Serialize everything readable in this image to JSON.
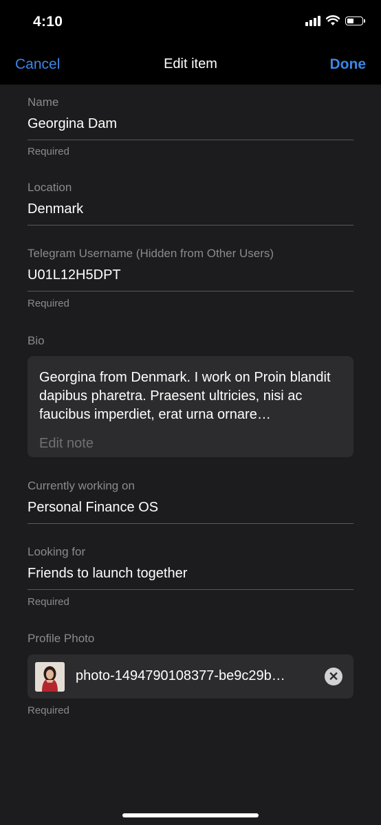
{
  "status": {
    "time": "4:10"
  },
  "nav": {
    "cancel": "Cancel",
    "title": "Edit item",
    "done": "Done"
  },
  "fields": {
    "name": {
      "label": "Name",
      "value": "Georgina Dam",
      "help": "Required"
    },
    "location": {
      "label": "Location",
      "value": "Denmark"
    },
    "telegram": {
      "label": "Telegram Username (Hidden from Other Users)",
      "value": "U01L12H5DPT",
      "help": "Required"
    },
    "bio": {
      "label": "Bio",
      "value": "Georgina from Denmark. I work on Proin blandit dapibus pharetra. Praesent ultricies, nisi ac faucibus imperdiet, erat urna ornare…",
      "edit_placeholder": "Edit note"
    },
    "working_on": {
      "label": "Currently working on",
      "value": "Personal Finance OS"
    },
    "looking_for": {
      "label": "Looking for",
      "value": "Friends to launch together",
      "help": "Required"
    },
    "photo": {
      "label": "Profile Photo",
      "filename": "photo-1494790108377-be9c29b…",
      "help": "Required"
    }
  },
  "icons": {
    "remove": "close-circle-icon",
    "thumbnail": "profile-photo-thumbnail"
  },
  "colors": {
    "accent": "#3b86e6",
    "background": "#1c1c1e",
    "card": "#2c2c2e"
  }
}
